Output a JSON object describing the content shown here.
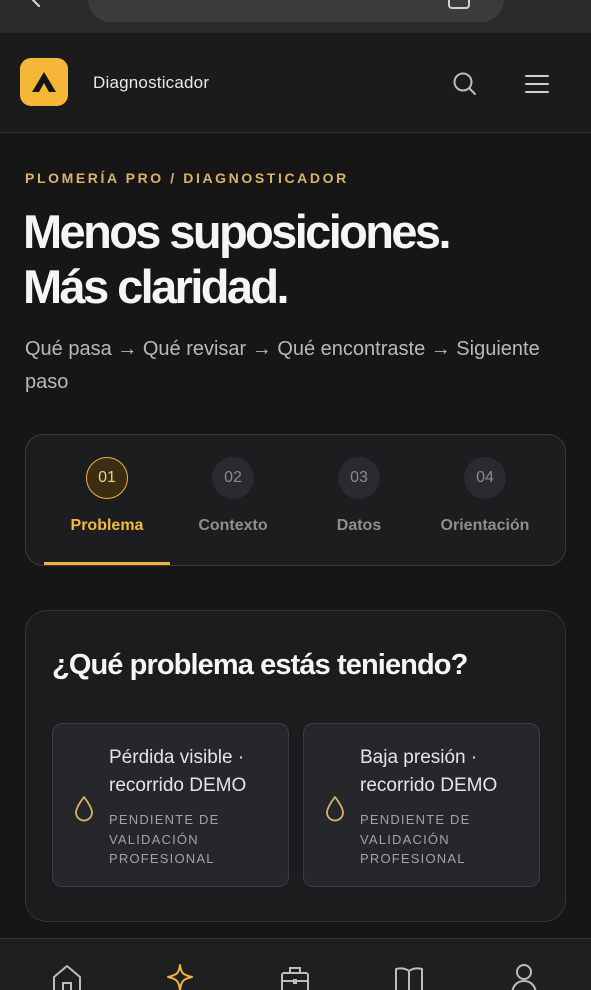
{
  "header": {
    "title": "Diagnosticador",
    "logo_letter": "A",
    "logo_color": "#f6b637",
    "icons": [
      "search-icon",
      "menu-icon"
    ]
  },
  "breadcrumb": "PLOMERÍA PRO / DIAGNOSTICADOR",
  "hero": {
    "title_line1": "Menos suposiciones.",
    "title_line2": "Más claridad.",
    "subtitle": "Qué pasa → Qué revisar → Qué encontraste → Siguiente paso"
  },
  "steps": [
    {
      "number": "01",
      "label": "Problema",
      "active": true
    },
    {
      "number": "02",
      "label": "Contexto",
      "active": false
    },
    {
      "number": "03",
      "label": "Datos",
      "active": false
    },
    {
      "number": "04",
      "label": "Orientación",
      "active": false
    }
  ],
  "question": {
    "title": "¿Qué problema estás teniendo?",
    "options": [
      {
        "title": "Pérdida visible · recorrido DEMO",
        "status": "PENDIENTE DE VALIDACIÓN PROFESIONAL",
        "icon": "water-drop-icon"
      },
      {
        "title": "Baja presión · recorrido DEMO",
        "status": "PENDIENTE DE VALIDACIÓN PROFESIONAL",
        "icon": "water-drop-icon"
      }
    ]
  },
  "bottom_nav": [
    {
      "icon": "home-icon"
    },
    {
      "icon": "sparkle-icon",
      "active": true
    },
    {
      "icon": "briefcase-icon"
    },
    {
      "icon": "book-icon"
    },
    {
      "icon": "user-icon"
    }
  ],
  "colors": {
    "accent": "#f0b33d",
    "background": "#161616",
    "card": "#1b1c1e"
  }
}
